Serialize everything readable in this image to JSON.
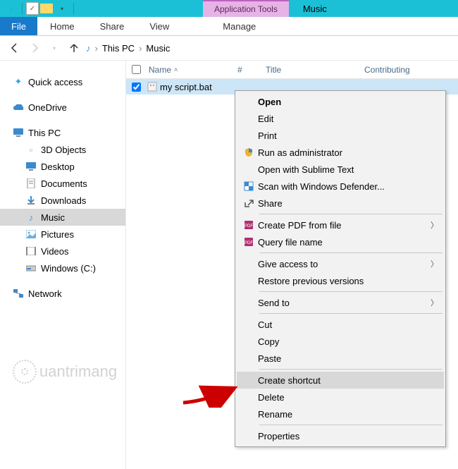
{
  "titlebar": {
    "context_tab": "Application Tools",
    "title": "Music"
  },
  "ribbon": {
    "file": "File",
    "tabs": [
      "Home",
      "Share",
      "View"
    ],
    "context_tab": "Manage"
  },
  "breadcrumb": {
    "root": "This PC",
    "folder": "Music"
  },
  "navpane": {
    "quick_access": "Quick access",
    "onedrive": "OneDrive",
    "this_pc": "This PC",
    "children": [
      {
        "label": "3D Objects",
        "icon": "cube"
      },
      {
        "label": "Desktop",
        "icon": "monitor"
      },
      {
        "label": "Documents",
        "icon": "doc"
      },
      {
        "label": "Downloads",
        "icon": "down"
      },
      {
        "label": "Music",
        "icon": "music",
        "selected": true
      },
      {
        "label": "Pictures",
        "icon": "pic"
      },
      {
        "label": "Videos",
        "icon": "vid"
      },
      {
        "label": "Windows (C:)",
        "icon": "drive"
      }
    ],
    "network": "Network"
  },
  "columns": {
    "name": "Name",
    "num": "#",
    "title": "Title",
    "contributing": "Contributing"
  },
  "file": {
    "name": "my script.bat"
  },
  "context_menu": {
    "open": "Open",
    "edit": "Edit",
    "print": "Print",
    "run_admin": "Run as administrator",
    "sublime": "Open with Sublime Text",
    "defender": "Scan with Windows Defender...",
    "share": "Share",
    "create_pdf": "Create PDF from file",
    "query_file": "Query file name",
    "give_access": "Give access to",
    "restore": "Restore previous versions",
    "send_to": "Send to",
    "cut": "Cut",
    "copy": "Copy",
    "paste": "Paste",
    "create_shortcut": "Create shortcut",
    "delete": "Delete",
    "rename": "Rename",
    "properties": "Properties"
  },
  "watermark": "uantrimang"
}
